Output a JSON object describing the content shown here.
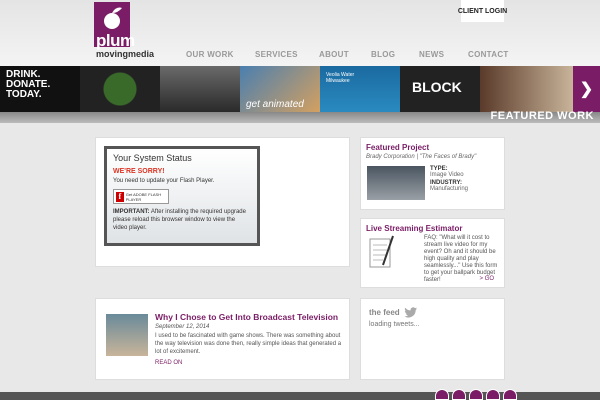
{
  "brand": {
    "name": "plum",
    "tagline": "movingmedia",
    "accent": "#7a1d66"
  },
  "header": {
    "client_login": "CLIENT LOGIN",
    "nav": [
      "OUR WORK",
      "SERVICES",
      "ABOUT",
      "BLOG",
      "NEWS",
      "CONTACT"
    ]
  },
  "banner": {
    "label": "FEATURED WORK",
    "texts": [
      "DRINK.",
      "DONATE.",
      "TODAY.",
      "get animated",
      "Veolia Water Milwaukee",
      "BLOCK"
    ]
  },
  "status": {
    "title": "Your System Status",
    "sorry": "WE'RE SORRY!",
    "update": "You need to update your Flash Player.",
    "flash_button": "Get ADOBE FLASH PLAYER",
    "important": "IMPORTANT:",
    "important_text": "After installing the required upgrade please reload this browser window to view the video player."
  },
  "featured": {
    "title": "Featured Project",
    "client": "Brady Corporation",
    "sep": " | ",
    "project": "\"The Faces of Brady\"",
    "type_label": "TYPE:",
    "type_value": "Image Video",
    "industry_label": "INDUSTRY:",
    "industry_value": "Manufacturing"
  },
  "estimator": {
    "title": "Live Streaming Estimator",
    "faq": "FAQ: \"What will it cost to stream live video for my event? Oh and it should be high quality and play seamlessly...\" Use this form to get your ballpark budget faster!",
    "go": "> GO"
  },
  "blog": {
    "title": "Why I Chose to Get Into Broadcast Television",
    "date": "September 12, 2014",
    "excerpt": "I used to be fascinated with game shows. There was something about the way television was done then, really simple ideas that generated a lot of excitement.",
    "read_on": "READ ON"
  },
  "feed": {
    "title": "the feed",
    "status": "loading tweets..."
  },
  "icons": [
    "twitter-icon",
    "facebook-icon",
    "youtube-icon",
    "vimeo-icon",
    "linkedin-icon"
  ]
}
